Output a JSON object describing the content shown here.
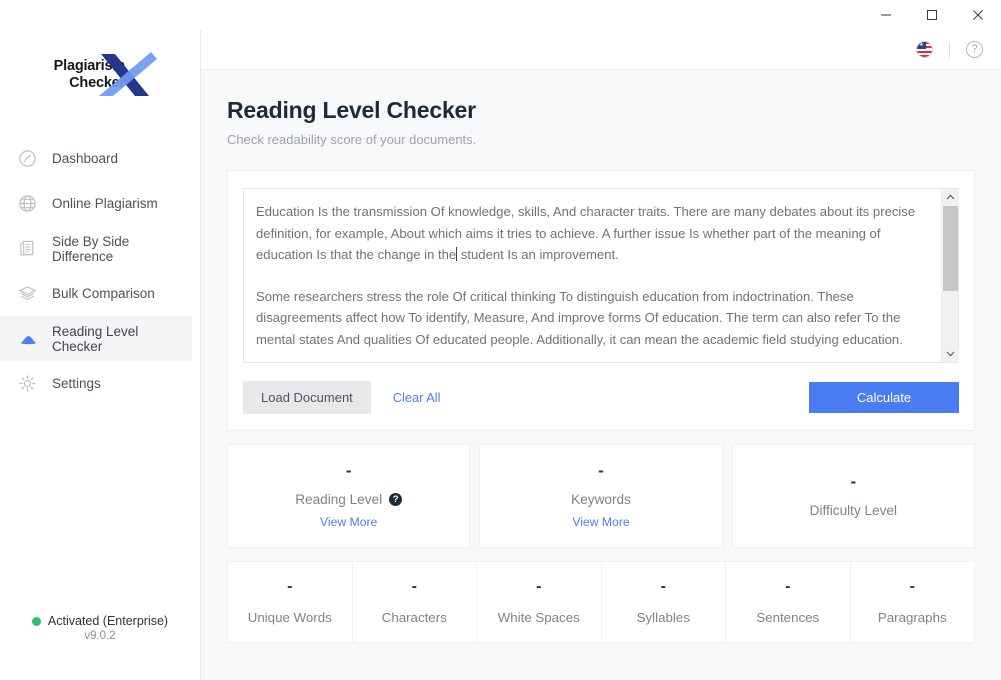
{
  "window": {
    "minimize_label": "minimize",
    "maximize_label": "maximize",
    "close_label": "close"
  },
  "sidebar": {
    "logo": {
      "line1": "Plagiarism",
      "line2": "Checker",
      "mark": "X"
    },
    "items": [
      {
        "label": "Dashboard",
        "icon": "gauge-icon",
        "active": false
      },
      {
        "label": "Online Plagiarism",
        "icon": "globe-icon",
        "active": false
      },
      {
        "label": "Side By Side Difference",
        "icon": "documents-icon",
        "active": false
      },
      {
        "label": "Bulk Comparison",
        "icon": "layers-icon",
        "active": false
      },
      {
        "label": "Reading Level Checker",
        "icon": "cloud-icon",
        "active": true
      },
      {
        "label": "Settings",
        "icon": "gear-icon",
        "active": false
      }
    ],
    "license": {
      "status": "Activated (Enterprise)",
      "version": "v9.0.2",
      "status_color": "#2fc06c"
    }
  },
  "topbar": {
    "language_icon": "us-flag-icon",
    "language_code": "US",
    "help_icon": "question-circle-icon",
    "help_glyph": "?"
  },
  "page": {
    "title": "Reading Level Checker",
    "subtitle": "Check readability score of your documents."
  },
  "editor": {
    "paragraph1_before_caret": "Education Is the transmission Of knowledge, skills, And character traits. There are many debates about its precise definition, for example, About which aims it tries to achieve. A further issue Is whether part of the meaning of education Is that the change in the",
    "paragraph1_after_caret": "student Is an improvement.",
    "paragraph2": "Some researchers stress the role Of critical thinking To distinguish education from indoctrination. These disagreements affect how To identify, Measure, And improve forms Of education. The term can also refer To the mental states And qualities Of educated people. Additionally, it can mean the academic field studying education.",
    "scroll_up_glyph": "⌃",
    "scroll_down_glyph": "⌄"
  },
  "actions": {
    "load_document": "Load Document",
    "clear_all": "Clear All",
    "calculate": "Calculate",
    "calculate_color": "#4b7cf3",
    "link_color": "#4f7df3"
  },
  "results": [
    {
      "value": "-",
      "label": "Reading Level",
      "has_help": true,
      "help_glyph": "?",
      "view_more": "View More"
    },
    {
      "value": "-",
      "label": "Keywords",
      "has_help": false,
      "view_more": "View More"
    },
    {
      "value": "-",
      "label": "Difficulty Level",
      "has_help": false,
      "view_more": ""
    }
  ],
  "stats": [
    {
      "value": "-",
      "label": "Unique Words"
    },
    {
      "value": "-",
      "label": "Characters"
    },
    {
      "value": "-",
      "label": "White Spaces"
    },
    {
      "value": "-",
      "label": "Syllables"
    },
    {
      "value": "-",
      "label": "Sentences"
    },
    {
      "value": "-",
      "label": "Paragraphs"
    }
  ]
}
